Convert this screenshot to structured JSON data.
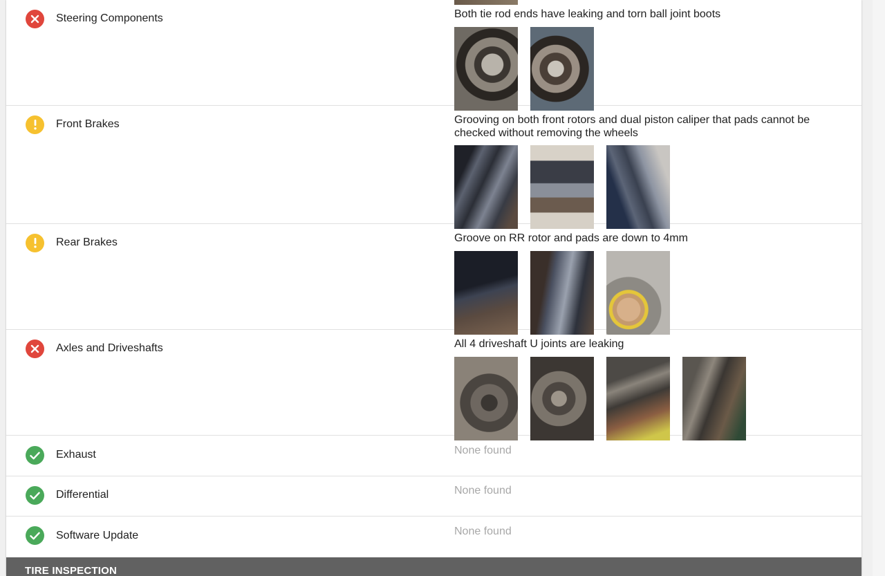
{
  "section_header": "TIRE INSPECTION",
  "colors": {
    "fail": "#e0463c",
    "warn": "#f6c12f",
    "pass": "#4aa95a",
    "bar": "#616161"
  },
  "rows": [
    {
      "label": "Steering Components",
      "status": "fail-icon",
      "note": "Both tie rod ends have leaking and torn ball joint boots",
      "photo_count": 2
    },
    {
      "label": "Front Brakes",
      "status": "warning-icon",
      "note": "Grooving on both front rotors and dual piston caliper that pads cannot be checked without removing the wheels",
      "photo_count": 3
    },
    {
      "label": "Rear Brakes",
      "status": "warning-icon",
      "note": "Groove on RR rotor and pads are down to 4mm",
      "photo_count": 3
    },
    {
      "label": "Axles and Driveshafts",
      "status": "fail-icon",
      "note": "All 4 driveshaft U joints are leaking",
      "photo_count": 4
    },
    {
      "label": "Exhaust",
      "status": "check-icon",
      "note": "None found"
    },
    {
      "label": "Differential",
      "status": "check-icon",
      "note": "None found"
    },
    {
      "label": "Software Update",
      "status": "check-icon",
      "note": "None found"
    }
  ]
}
